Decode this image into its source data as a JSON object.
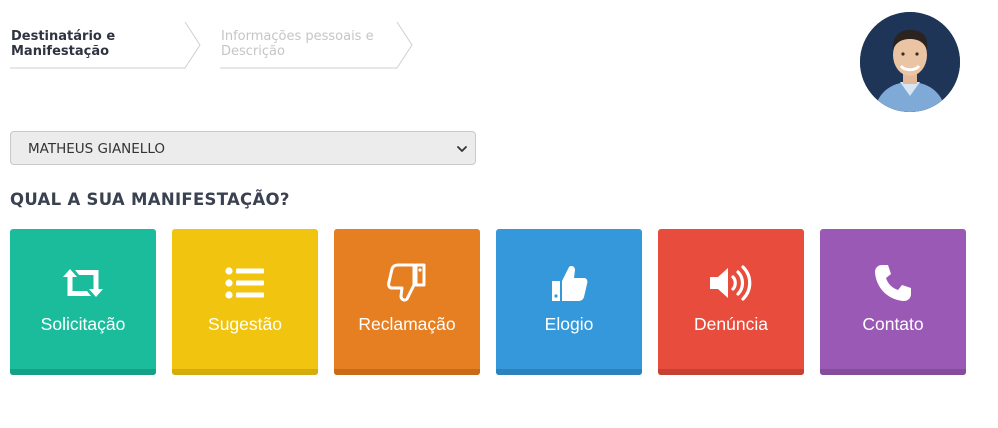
{
  "steps": [
    {
      "label": "Destinatário e Manifestação",
      "state": "active"
    },
    {
      "label": "Informações pessoais e Descrição",
      "state": "inactive"
    }
  ],
  "avatar": {
    "icon": "user-photo-avatar"
  },
  "recipient_select": {
    "value": "MATHEUS GIANELLO"
  },
  "question": "QUAL A SUA MANIFESTAÇÃO?",
  "tiles": [
    {
      "label": "Solicitação",
      "icon": "retweet-icon",
      "color": "#1abc9c",
      "shade": "#16a085"
    },
    {
      "label": "Sugestão",
      "icon": "list-icon",
      "color": "#f1c40f",
      "shade": "#d4ac0d"
    },
    {
      "label": "Reclamação",
      "icon": "thumbs-down-icon",
      "color": "#e67e22",
      "shade": "#c86a17"
    },
    {
      "label": "Elogio",
      "icon": "thumbs-up-icon",
      "color": "#3498db",
      "shade": "#2c82bb"
    },
    {
      "label": "Denúncia",
      "icon": "volume-icon",
      "color": "#e74c3c",
      "shade": "#c44133"
    },
    {
      "label": "Contato",
      "icon": "phone-icon",
      "color": "#9b59b6",
      "shade": "#854c9c"
    }
  ]
}
